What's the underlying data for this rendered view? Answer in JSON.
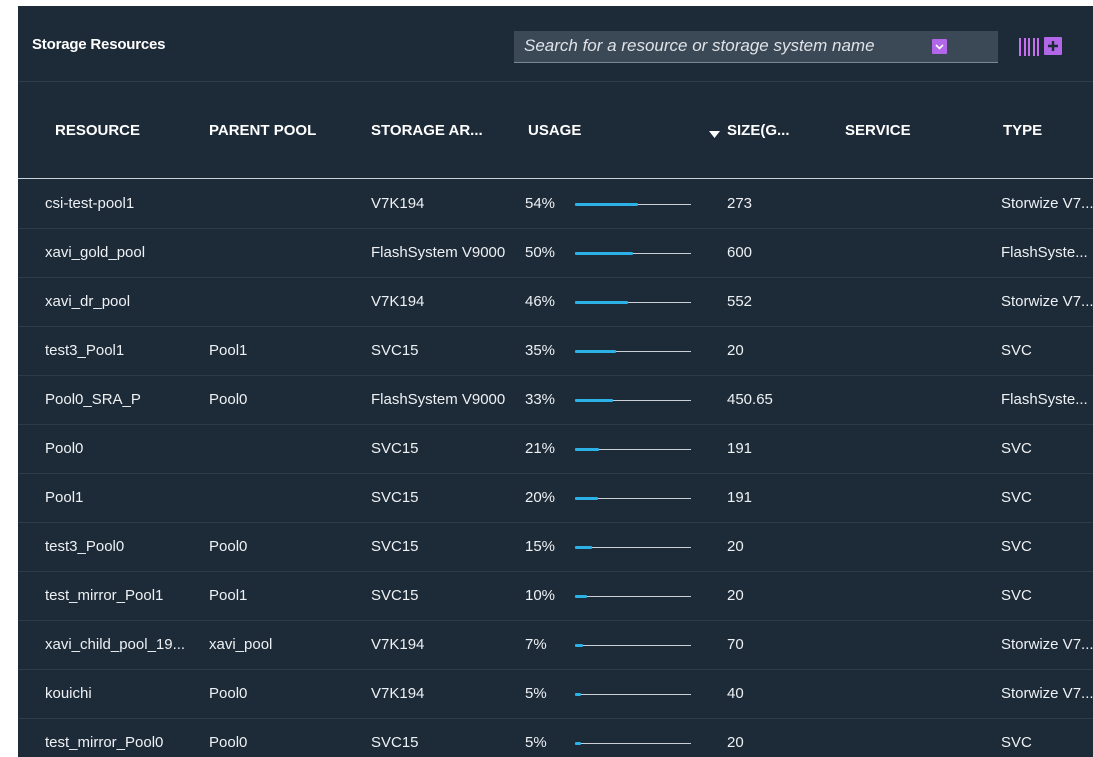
{
  "panel": {
    "title": "Storage Resources"
  },
  "search": {
    "placeholder": "Search for a resource or storage system name"
  },
  "icons": {
    "dropdown": "chevron-down-icon",
    "columns": "columns-icon",
    "add": "plus-icon",
    "sort": "sort-descending-icon"
  },
  "colors": {
    "accent": "#b266e8",
    "usage_bar": "#2bb1e6",
    "panel_bg": "#1d2a37"
  },
  "table": {
    "columns": [
      "RESOURCE",
      "PARENT POOL",
      "STORAGE AR...",
      "USAGE",
      "SIZE(G...",
      "SERVICE",
      "TYPE"
    ],
    "sorted_by": "USAGE",
    "rows": [
      {
        "resource": "csi-test-pool1",
        "parent_pool": "",
        "storage_system": "V7K194",
        "usage": "54%",
        "usage_value": 54,
        "size": "273",
        "service": "",
        "type": "Storwize V7..."
      },
      {
        "resource": "xavi_gold_pool",
        "parent_pool": "",
        "storage_system": "FlashSystem V9000",
        "usage": "50%",
        "usage_value": 50,
        "size": "600",
        "service": "",
        "type": "FlashSyste..."
      },
      {
        "resource": "xavi_dr_pool",
        "parent_pool": "",
        "storage_system": "V7K194",
        "usage": "46%",
        "usage_value": 46,
        "size": "552",
        "service": "",
        "type": "Storwize V7..."
      },
      {
        "resource": "test3_Pool1",
        "parent_pool": "Pool1",
        "storage_system": "SVC15",
        "usage": "35%",
        "usage_value": 35,
        "size": "20",
        "service": "",
        "type": "SVC"
      },
      {
        "resource": "Pool0_SRA_P",
        "parent_pool": "Pool0",
        "storage_system": "FlashSystem V9000",
        "usage": "33%",
        "usage_value": 33,
        "size": "450.65",
        "service": "",
        "type": "FlashSyste..."
      },
      {
        "resource": "Pool0",
        "parent_pool": "",
        "storage_system": "SVC15",
        "usage": "21%",
        "usage_value": 21,
        "size": "191",
        "service": "",
        "type": "SVC"
      },
      {
        "resource": "Pool1",
        "parent_pool": "",
        "storage_system": "SVC15",
        "usage": "20%",
        "usage_value": 20,
        "size": "191",
        "service": "",
        "type": "SVC"
      },
      {
        "resource": "test3_Pool0",
        "parent_pool": "Pool0",
        "storage_system": "SVC15",
        "usage": "15%",
        "usage_value": 15,
        "size": "20",
        "service": "",
        "type": "SVC"
      },
      {
        "resource": "test_mirror_Pool1",
        "parent_pool": "Pool1",
        "storage_system": "SVC15",
        "usage": "10%",
        "usage_value": 10,
        "size": "20",
        "service": "",
        "type": "SVC"
      },
      {
        "resource": "xavi_child_pool_19...",
        "parent_pool": "xavi_pool",
        "storage_system": "V7K194",
        "usage": "7%",
        "usage_value": 7,
        "size": "70",
        "service": "",
        "type": "Storwize V7..."
      },
      {
        "resource": "kouichi",
        "parent_pool": "Pool0",
        "storage_system": "V7K194",
        "usage": "5%",
        "usage_value": 5,
        "size": "40",
        "service": "",
        "type": "Storwize V7..."
      },
      {
        "resource": "test_mirror_Pool0",
        "parent_pool": "Pool0",
        "storage_system": "SVC15",
        "usage": "5%",
        "usage_value": 5,
        "size": "20",
        "service": "",
        "type": "SVC"
      }
    ]
  }
}
